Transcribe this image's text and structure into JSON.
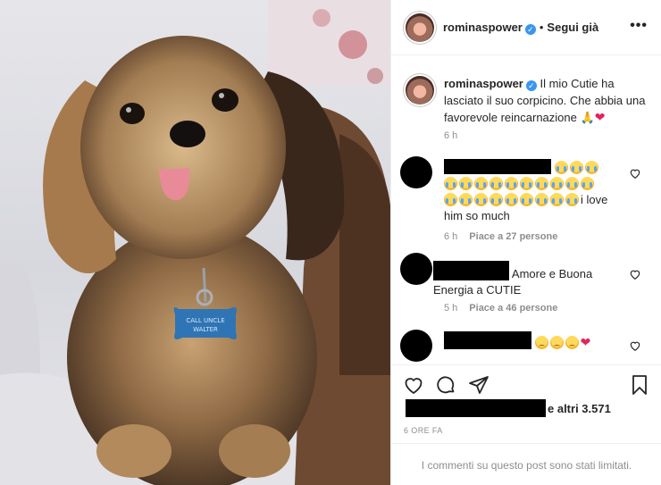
{
  "post": {
    "author": "rominaspower",
    "follow_state": "Segui già",
    "separator": "•",
    "more": "•••",
    "caption": "Il mio Cutie ha lasciato il suo corpicino. Che abbia una favorevole reincarnazione",
    "caption_time": "6 h",
    "tag_text": "CALL UNCLE WALTER"
  },
  "comments": [
    {
      "text_after": "i love him so much",
      "time": "6 h",
      "likes": "Piace a 27 persone"
    },
    {
      "text_after": " Amore e Buona Energia a CUTIE",
      "time": "5 h",
      "likes": "Piace a 46 persone"
    },
    {
      "text_after": ""
    }
  ],
  "likes_summary": "e altri 3.571",
  "post_time": "6 ORE FA",
  "comments_limited": "I commenti su questo post sono stati limitati.",
  "colors": {
    "verified": "#3897f0",
    "muted": "#8e8e8e",
    "heart": "#e0245e"
  },
  "icons": [
    "heart-icon",
    "comment-icon",
    "share-icon",
    "bookmark-icon",
    "verified-icon",
    "more-icon"
  ]
}
